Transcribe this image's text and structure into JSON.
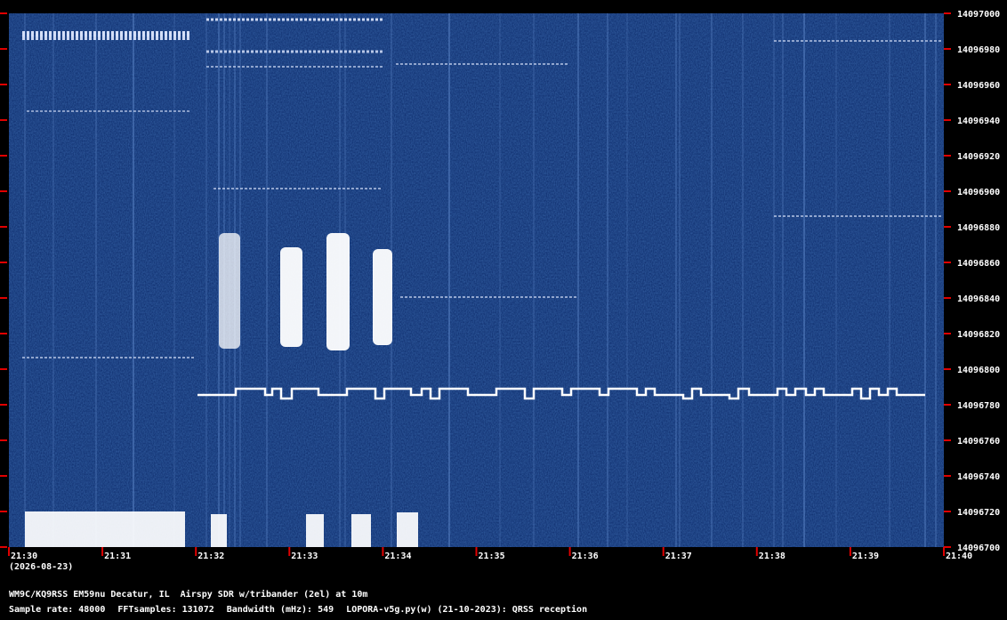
{
  "spectrogram": {
    "colors": {
      "background": "#000000",
      "waterfall_base": "#0c2a6a",
      "signal": "#ffffff",
      "tick": "#e00000"
    },
    "freq_labels": [
      "14097000",
      "14096980",
      "14096960",
      "14096940",
      "14096920",
      "14096900",
      "14096880",
      "14096860",
      "14096840",
      "14096820",
      "14096800",
      "14096780",
      "14096760",
      "14096740",
      "14096720",
      "14096700"
    ],
    "time_labels": [
      "21:30",
      "21:31",
      "21:32",
      "21:33",
      "21:34",
      "21:35",
      "21:36",
      "21:37",
      "21:38",
      "21:39",
      "21:40"
    ],
    "date_label": "(2026-08-23)"
  },
  "footer": {
    "station": "WM9C/KQ9RSS EM59nu Decatur, IL  Airspy SDR w/tribander (2el) at 10m",
    "sample_rate": "Sample rate: 48000",
    "fft_samples": "FFTsamples: 131072",
    "bandwidth": "Bandwidth (mHz): 549",
    "software": "LOPORA-v5g.py(w) (21-10-2023): QRSS reception"
  }
}
